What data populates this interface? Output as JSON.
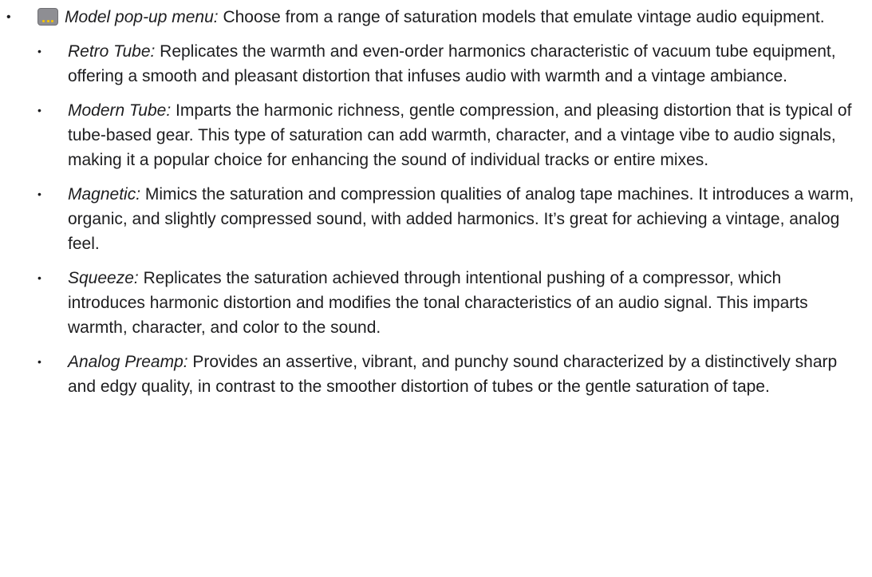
{
  "list": {
    "bullet_char": "•",
    "top_item": {
      "icon": "model-popup-menu-icon",
      "term": "Model pop-up menu:",
      "text": " Choose from a range of saturation models that emulate vintage audio equipment."
    },
    "sub_items": [
      {
        "term": "Retro Tube:",
        "text": " Replicates the warmth and even-order harmonics characteristic of vacuum tube equipment, offering a smooth and pleasant distortion that infuses audio with warmth and a vintage ambiance."
      },
      {
        "term": "Modern Tube:",
        "text": " Imparts the harmonic richness, gentle compression, and pleasing distortion that is typical of tube-based gear. This type of saturation can add warmth, character, and a vintage vibe to audio signals, making it a popular choice for enhancing the sound of individual tracks or entire mixes."
      },
      {
        "term": "Magnetic:",
        "text": " Mimics the saturation and compression qualities of analog tape machines. It introduces a warm, organic, and slightly compressed sound, with added harmonics. It’s great for achieving a vintage, analog feel."
      },
      {
        "term": "Squeeze:",
        "text": " Replicates the saturation achieved through intentional pushing of a compressor, which introduces harmonic distortion and modifies the tonal characteristics of an audio signal. This imparts warmth, character, and color to the sound."
      },
      {
        "term": "Analog Preamp:",
        "text": " Provides an assertive, vibrant, and punchy sound characterized by a distinctively sharp and edgy quality, in contrast to the smoother distortion of tubes or the gentle saturation of tape."
      }
    ]
  },
  "colors": {
    "text": "#1d1d1f",
    "icon_body": "#8e8e93",
    "icon_dots": "#f5c400"
  }
}
